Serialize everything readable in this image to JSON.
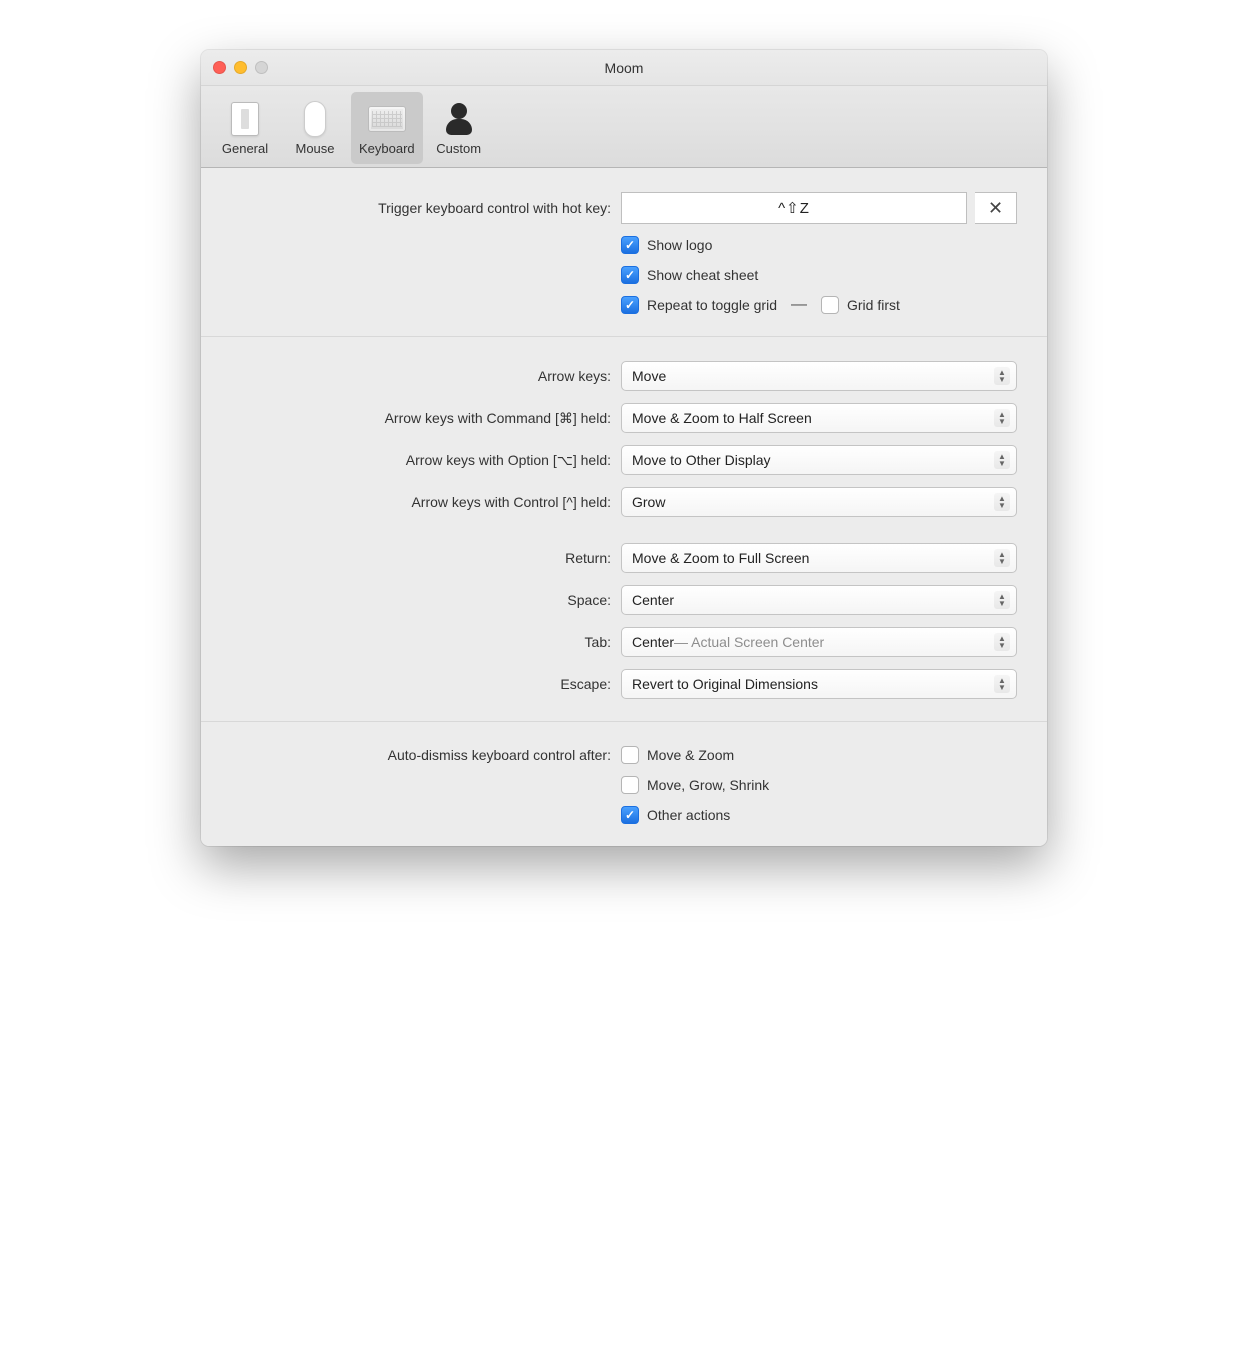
{
  "window": {
    "title": "Moom"
  },
  "tabs": {
    "general": "General",
    "mouse": "Mouse",
    "keyboard": "Keyboard",
    "custom": "Custom",
    "selected": "Keyboard"
  },
  "hotkey": {
    "label": "Trigger keyboard control with hot key:",
    "value": "^⇧Z",
    "clear": "✕"
  },
  "options": {
    "show_logo": {
      "label": "Show logo",
      "checked": true
    },
    "show_cheat": {
      "label": "Show cheat sheet",
      "checked": true
    },
    "repeat_toggle": {
      "label": "Repeat to toggle grid",
      "checked": true
    },
    "dash": "—",
    "grid_first": {
      "label": "Grid first",
      "checked": false
    }
  },
  "arrow": {
    "plain": {
      "label": "Arrow keys:",
      "value": "Move"
    },
    "cmd": {
      "label": "Arrow keys with Command [⌘] held:",
      "value": "Move & Zoom to Half Screen"
    },
    "opt": {
      "label": "Arrow keys with Option [⌥] held:",
      "value": "Move to Other Display"
    },
    "ctrl": {
      "label": "Arrow keys with Control [^] held:",
      "value": "Grow"
    }
  },
  "keys": {
    "return": {
      "label": "Return:",
      "value": "Move & Zoom to Full Screen"
    },
    "space": {
      "label": "Space:",
      "value": "Center"
    },
    "tab": {
      "label": "Tab:",
      "value": "Center",
      "tail": " — Actual Screen Center"
    },
    "escape": {
      "label": "Escape:",
      "value": "Revert to Original Dimensions"
    }
  },
  "dismiss": {
    "label": "Auto-dismiss keyboard control after:",
    "move_zoom": {
      "label": "Move & Zoom",
      "checked": false
    },
    "move_grow": {
      "label": "Move, Grow, Shrink",
      "checked": false
    },
    "other": {
      "label": "Other actions",
      "checked": true
    }
  }
}
